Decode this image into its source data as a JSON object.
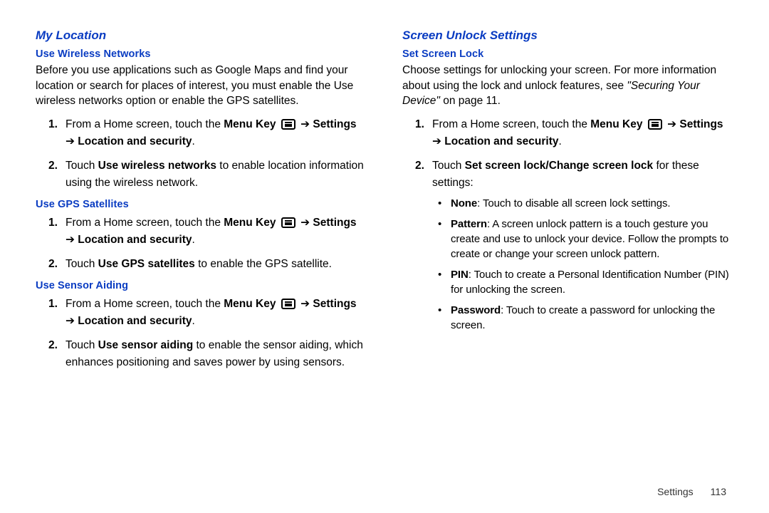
{
  "left": {
    "title": "My Location",
    "s1": {
      "heading": "Use Wireless Networks",
      "para": "Before you use applications such as Google Maps and find your location or search for places of interest, you must enable the Use wireless networks option or enable the GPS satellites.",
      "step1_a": "From a Home screen, touch the ",
      "step1_b": "Menu Key",
      "step1_arrow1": " ➔ ",
      "step1_c": "Settings",
      "step1_arrow2": " ➔ ",
      "step1_d": "Location and security",
      "step1_dot": ".",
      "step2_a": "Touch ",
      "step2_b": "Use wireless networks",
      "step2_c": " to enable location information using the wireless network."
    },
    "s2": {
      "heading": "Use GPS Satellites",
      "step1_a": "From a Home screen, touch the ",
      "step1_b": "Menu Key",
      "step1_arrow1": " ➔ ",
      "step1_c": "Settings",
      "step1_arrow2": " ➔ ",
      "step1_d": "Location and security",
      "step1_dot": ".",
      "step2_a": "Touch ",
      "step2_b": "Use GPS satellites",
      "step2_c": " to enable the GPS satellite."
    },
    "s3": {
      "heading": "Use Sensor Aiding",
      "step1_a": "From a Home screen, touch the ",
      "step1_b": "Menu Key",
      "step1_arrow1": " ➔ ",
      "step1_c": "Settings",
      "step1_arrow2": " ➔ ",
      "step1_d": "Location and security",
      "step1_dot": ".",
      "step2_a": "Touch ",
      "step2_b": "Use sensor aiding",
      "step2_c": " to enable the sensor aiding, which enhances positioning and saves power by using sensors."
    }
  },
  "right": {
    "title": "Screen Unlock Settings",
    "s1": {
      "heading": "Set Screen Lock",
      "para_a": "Choose settings for unlocking your screen. For more information about using the lock and unlock features, see ",
      "para_b": "\"Securing Your Device\"",
      "para_c": " on page 11.",
      "step1_a": "From a Home screen, touch the ",
      "step1_b": "Menu Key",
      "step1_arrow1": " ➔ ",
      "step1_c": "Settings",
      "step1_arrow2": " ➔ ",
      "step1_d": "Location and security",
      "step1_dot": ".",
      "step2_a": "Touch ",
      "step2_b": "Set screen lock/Change screen lock",
      "step2_c": " for these settings:",
      "bullets": {
        "b1_a": "None",
        "b1_b": ": Touch to disable all screen lock settings.",
        "b2_a": "Pattern",
        "b2_b": ": A screen unlock pattern is a touch gesture you create and use to unlock your device. Follow the prompts to create or change your screen unlock pattern.",
        "b3_a": "PIN",
        "b3_b": ": Touch to create a Personal Identification Number (PIN) for unlocking the screen.",
        "b4_a": "Password",
        "b4_b": ": Touch to create a password for unlocking the screen."
      }
    }
  },
  "footer": {
    "label": "Settings",
    "page": "113"
  },
  "num": {
    "one": "1.",
    "two": "2."
  },
  "bullet_char": "•"
}
